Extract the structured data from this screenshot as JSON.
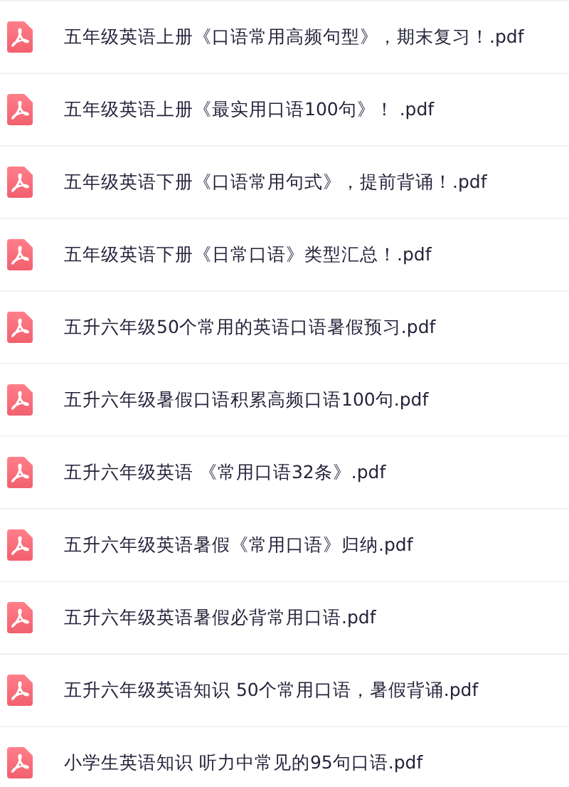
{
  "files": [
    {
      "name": "五年级英语上册《口语常用高频句型》，期末复习！.pdf"
    },
    {
      "name": "五年级英语上册《最实用口语100句》！ .pdf"
    },
    {
      "name": "五年级英语下册《口语常用句式》，提前背诵！.pdf"
    },
    {
      "name": "五年级英语下册《日常口语》类型汇总！.pdf"
    },
    {
      "name": "五升六年级50个常用的英语口语暑假预习.pdf"
    },
    {
      "name": "五升六年级暑假口语积累高频口语100句.pdf"
    },
    {
      "name": "五升六年级英语 《常用口语32条》.pdf"
    },
    {
      "name": "五升六年级英语暑假《常用口语》归纳.pdf"
    },
    {
      "name": "五升六年级英语暑假必背常用口语.pdf"
    },
    {
      "name": "五升六年级英语知识 50个常用口语，暑假背诵.pdf"
    },
    {
      "name": "小学生英语知识 听力中常见的95句口语.pdf"
    }
  ]
}
